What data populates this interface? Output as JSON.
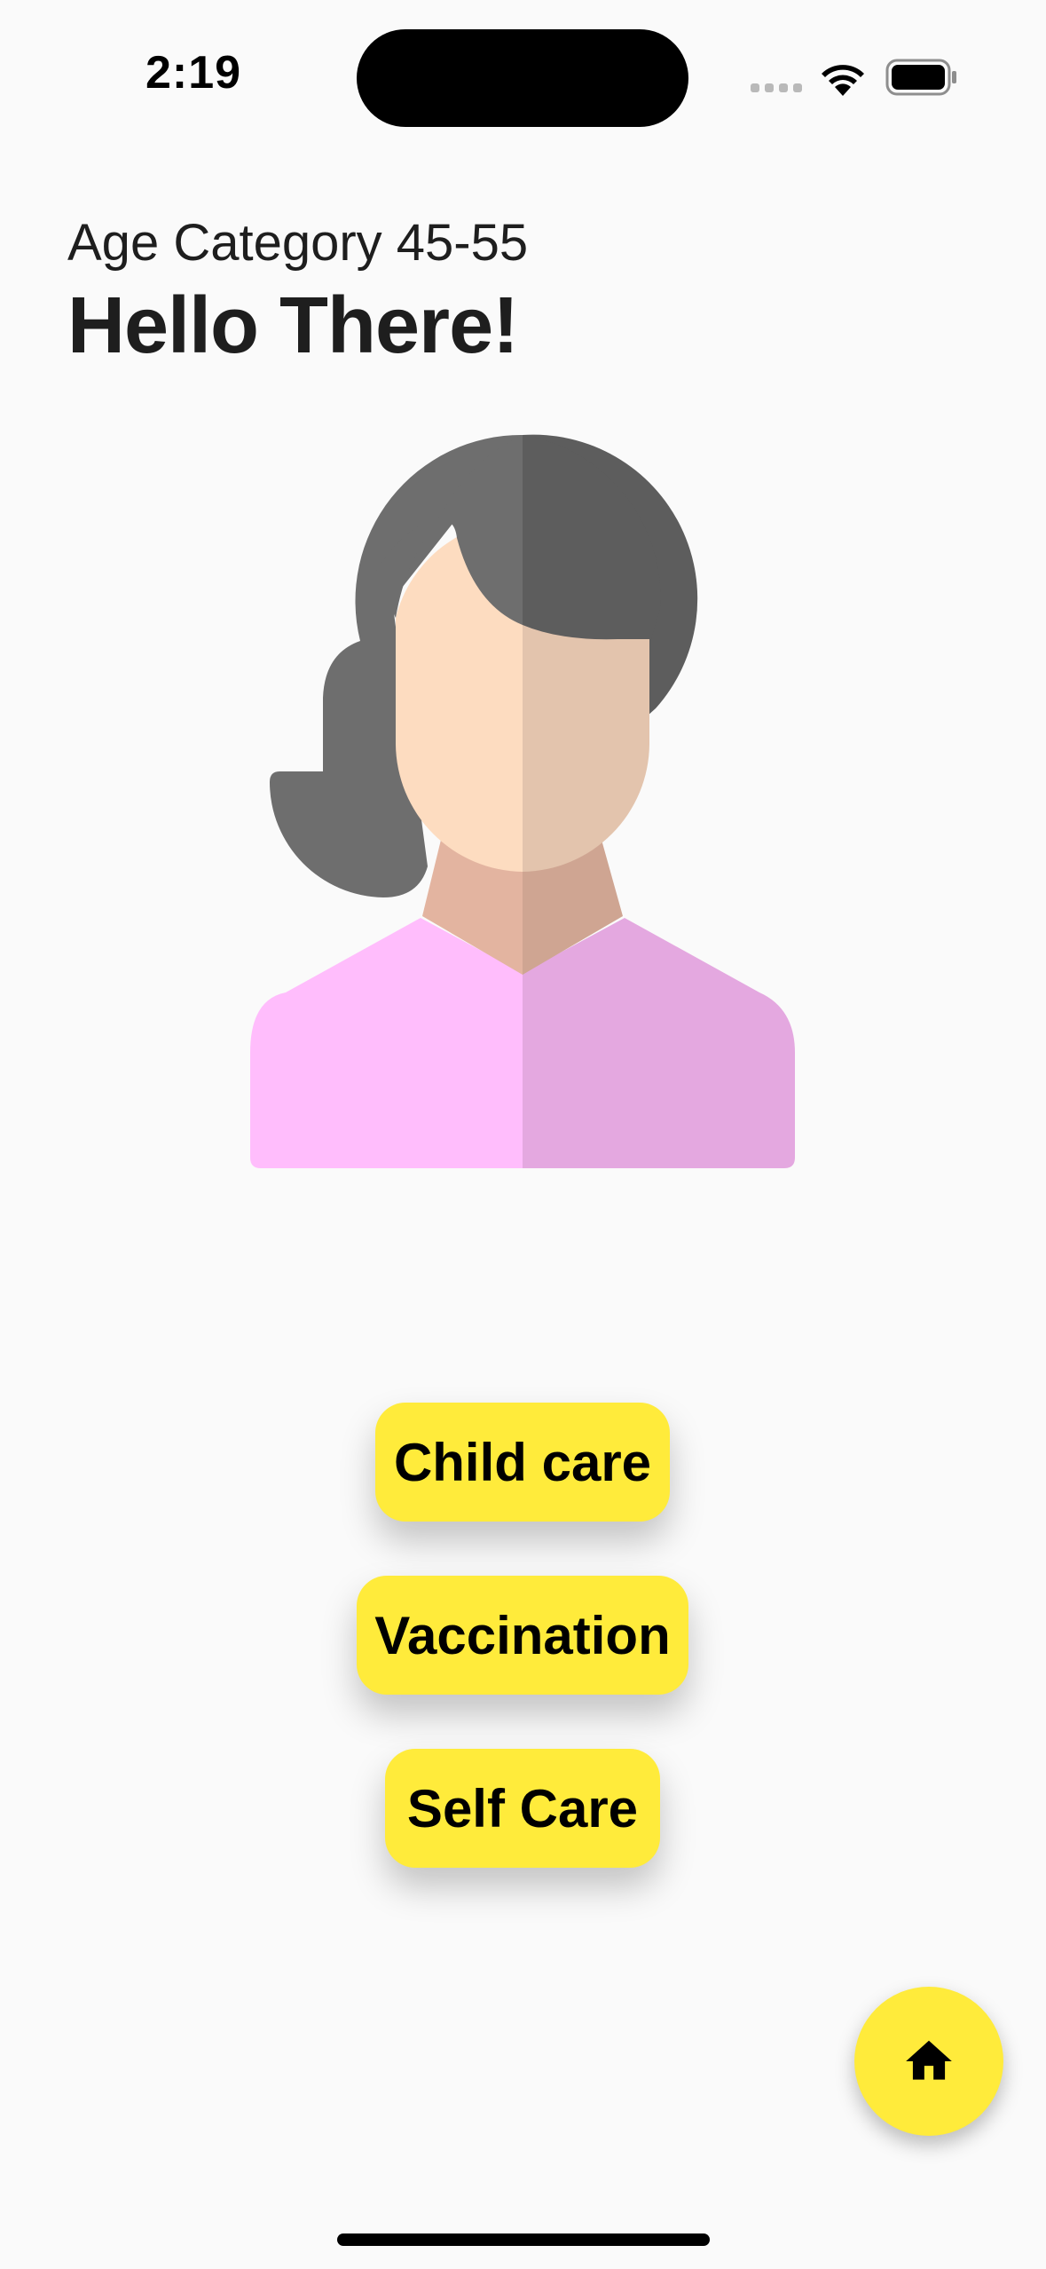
{
  "status_bar": {
    "time": "2:19"
  },
  "header": {
    "age_category": "Age Category 45-55",
    "greeting": "Hello There!"
  },
  "avatar": {
    "icon": "woman-avatar-icon",
    "colors": {
      "hair_light": "#6e6e6e",
      "hair_dark": "#5d5d5d",
      "skin_light": "#fddcc0",
      "skin_dark": "#e3c4ad",
      "neck_light": "#e3b4a0",
      "neck_dark": "#cfa592",
      "shirt_light": "#ffbdfc",
      "shirt_dark": "#e4a8e0"
    }
  },
  "actions": [
    {
      "label": "Child care"
    },
    {
      "label": "Vaccination"
    },
    {
      "label": "Self Care"
    }
  ],
  "fab": {
    "icon": "home-icon"
  },
  "theme": {
    "accent": "#ffeb3b",
    "background": "#fafafa",
    "text": "#1e1e1e"
  }
}
